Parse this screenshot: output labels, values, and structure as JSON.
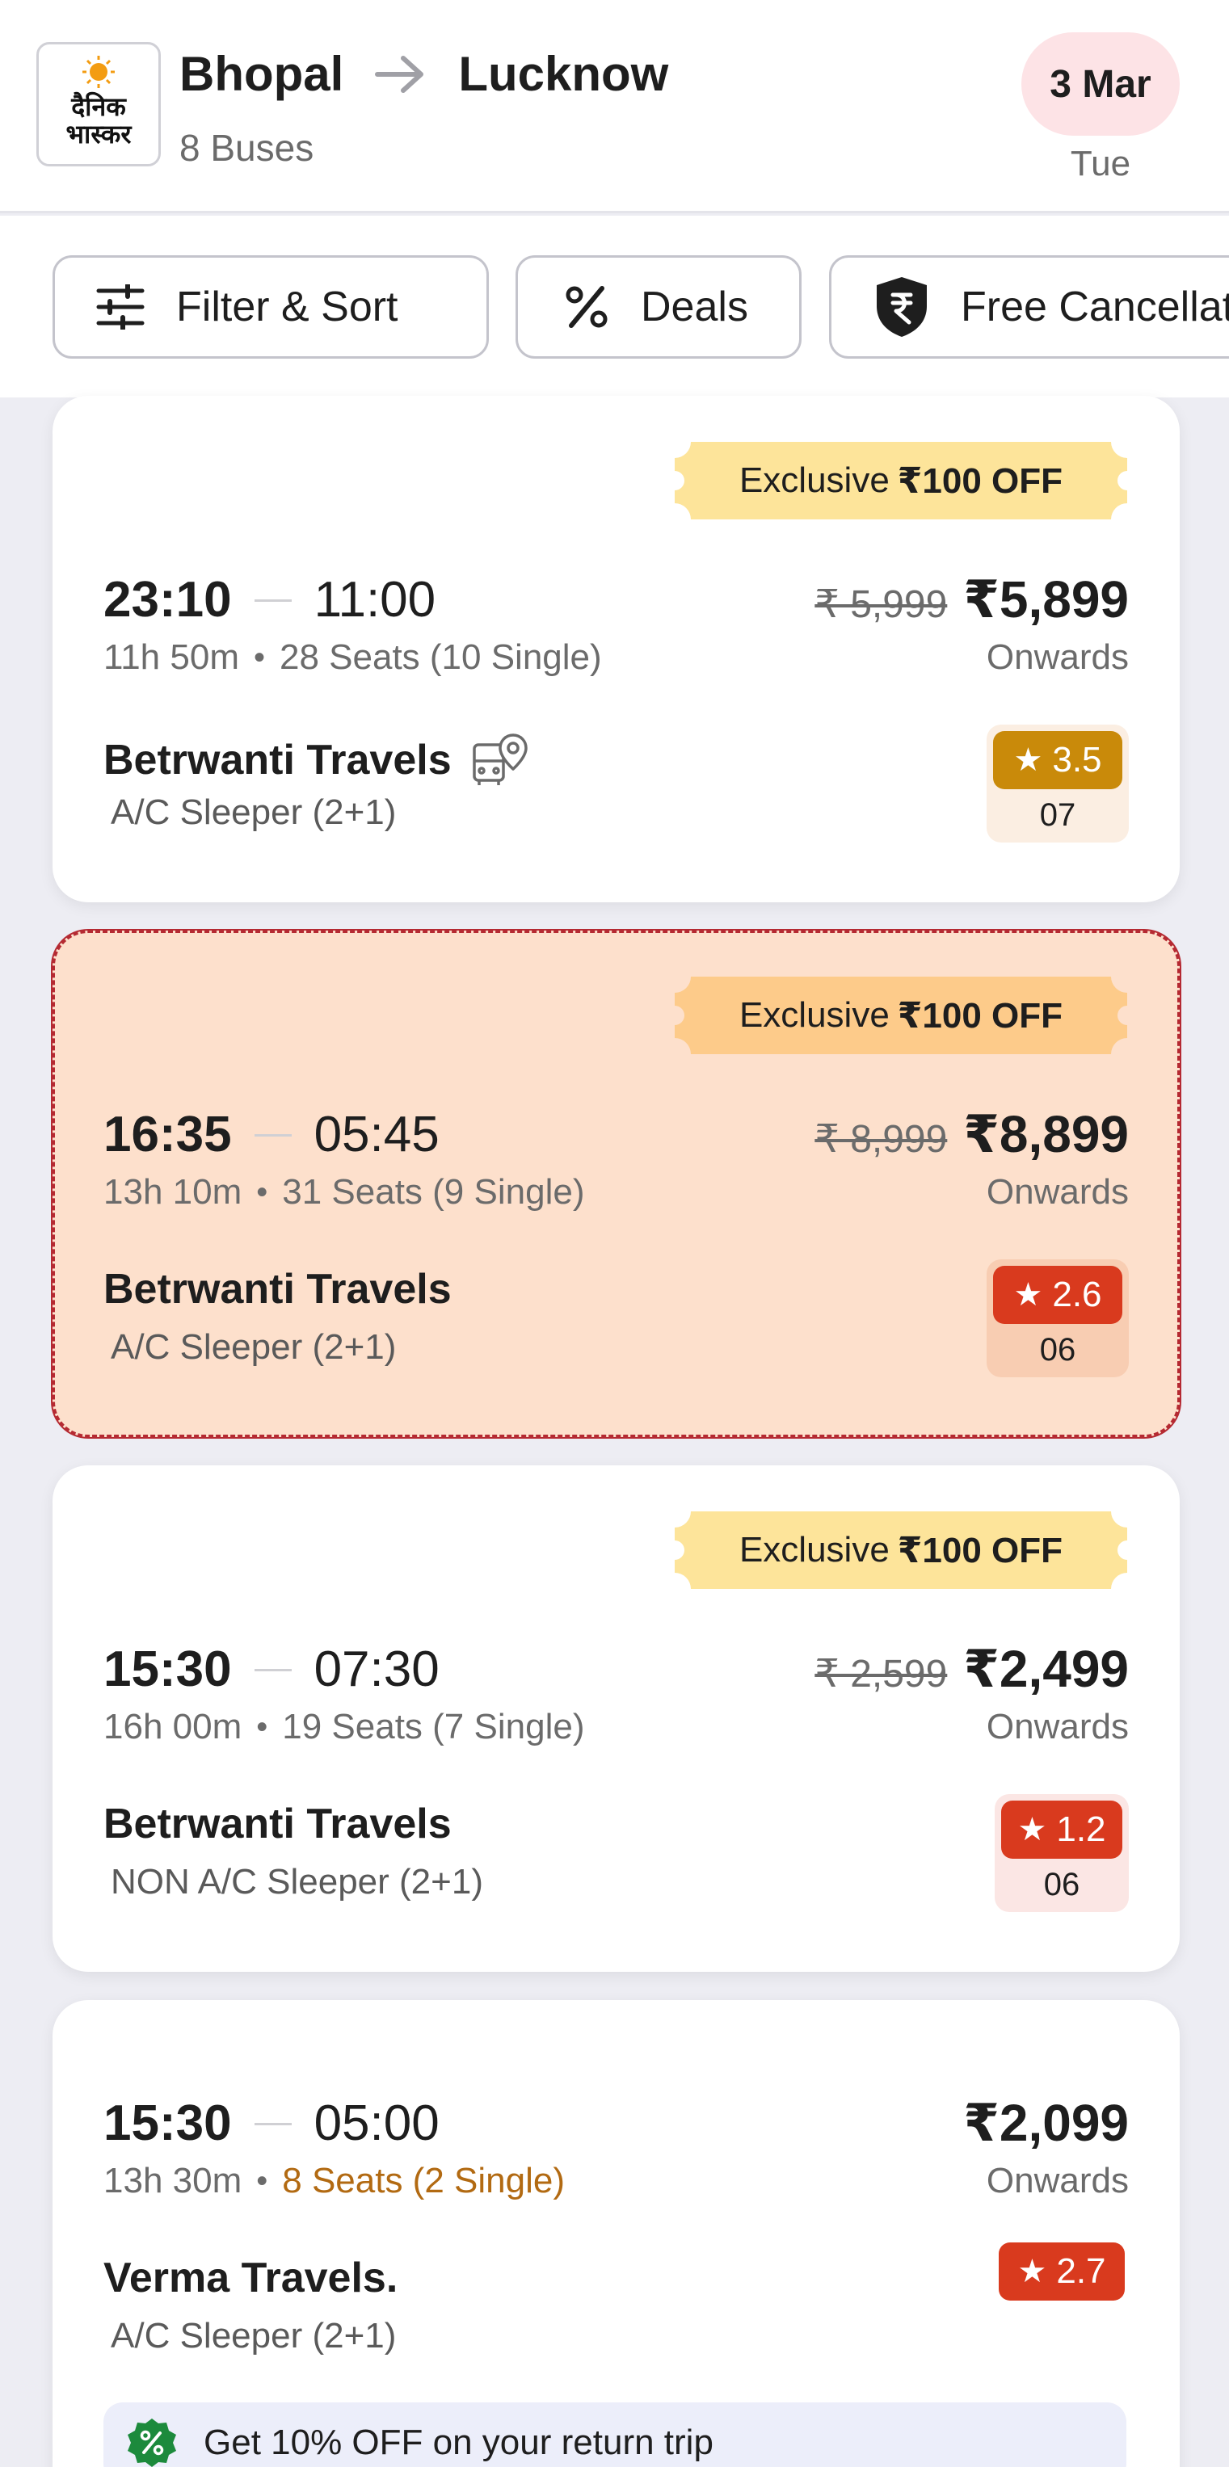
{
  "header": {
    "origin": "Bhopal",
    "destination": "Lucknow",
    "bus_count": "8 Buses",
    "date": "3 Mar",
    "day": "Tue",
    "logo_icon": "dainik-bhaskar-logo",
    "logo_text_line1": "दैनिक",
    "logo_text_line2": "भास्कर"
  },
  "filters": [
    {
      "label": "Filter & Sort",
      "icon": "sliders-icon"
    },
    {
      "label": "Deals",
      "icon": "percent-icon"
    },
    {
      "label": "Free Cancellation",
      "icon": "shield-rupee-icon"
    }
  ],
  "buses": [
    {
      "offer_prefix": "Exclusive",
      "offer_amount": "₹100 OFF",
      "departure": "23:10",
      "arrival": "11:00",
      "duration": "11h 50m",
      "seats": "28 Seats (10 Single)",
      "old_price": "₹ 5,999",
      "price": "₹5,899",
      "onwards": "Onwards",
      "operator": "Betrwanti Travels",
      "bus_type": "A/C Sleeper (2+1)",
      "rating": "3.5",
      "rating_count": "07"
    },
    {
      "offer_prefix": "Exclusive",
      "offer_amount": "₹100 OFF",
      "departure": "16:35",
      "arrival": "05:45",
      "duration": "13h 10m",
      "seats": "31 Seats (9 Single)",
      "old_price": "₹ 8,999",
      "price": "₹8,899",
      "onwards": "Onwards",
      "operator": "Betrwanti Travels",
      "bus_type": "A/C Sleeper (2+1)",
      "rating": "2.6",
      "rating_count": "06"
    },
    {
      "offer_prefix": "Exclusive",
      "offer_amount": "₹100 OFF",
      "departure": "15:30",
      "arrival": "07:30",
      "duration": "16h 00m",
      "seats": "19 Seats (7 Single)",
      "old_price": "₹ 2,599",
      "price": "₹2,499",
      "onwards": "Onwards",
      "operator": "Betrwanti Travels",
      "bus_type": "NON A/C Sleeper (2+1)",
      "rating": "1.2",
      "rating_count": "06"
    },
    {
      "departure": "15:30",
      "arrival": "05:00",
      "duration": "13h 30m",
      "seats": "8 Seats (2 Single)",
      "price": "₹2,099",
      "onwards": "Onwards",
      "operator": "Verma Travels.",
      "bus_type": "A/C Sleeper (2+1)",
      "rating": "2.7"
    }
  ],
  "promo": {
    "text": "Get 10% OFF on your return trip",
    "icon": "percent-badge-icon"
  },
  "colors": {
    "rating_gold": "#c98a0a",
    "rating_red": "#d93a1e",
    "highlight_bg": "#fde0cc",
    "offer_badge": "#fde49a",
    "warn_text": "#b26a12"
  }
}
